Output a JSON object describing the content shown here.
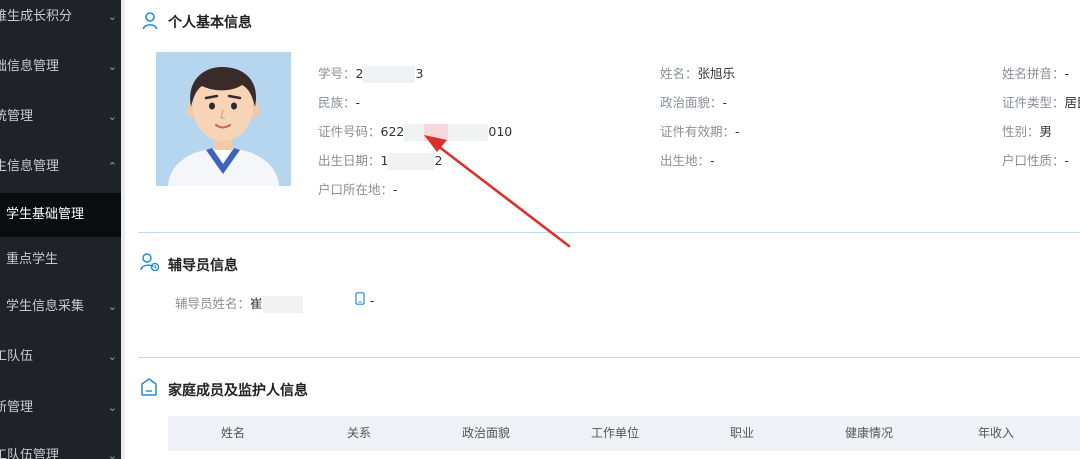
{
  "sidebar": {
    "items": [
      {
        "label": "难生成长积分",
        "arrow": "⌄"
      },
      {
        "label": "础信息管理",
        "arrow": "⌄"
      },
      {
        "label": "统管理",
        "arrow": "⌄"
      },
      {
        "label": "生信息管理",
        "arrow": "⌃"
      },
      {
        "label": "学生基础管理",
        "arrow": ""
      },
      {
        "label": "重点学生",
        "arrow": ""
      },
      {
        "label": "学生信息采集",
        "arrow": "⌄"
      },
      {
        "label": "工队伍",
        "arrow": "⌄"
      },
      {
        "label": "新管理",
        "arrow": "⌄"
      },
      {
        "label": "工队伍管理",
        "arrow": "⌄"
      }
    ]
  },
  "personal": {
    "title": "个人基本信息",
    "fields": {
      "student_id": {
        "label": "学号：",
        "value_pre": "2",
        "value_post": "3"
      },
      "name": {
        "label": "姓名：",
        "value": "张旭乐"
      },
      "name_pinyin": {
        "label": "姓名拼音：",
        "value": "-"
      },
      "ethnicity": {
        "label": "民族：",
        "value": "-"
      },
      "political": {
        "label": "政治面貌：",
        "value": "-"
      },
      "id_type": {
        "label": "证件类型：",
        "value": "居民"
      },
      "id_number": {
        "label": "证件号码：",
        "value_pre": "622",
        "value_post": "010"
      },
      "id_validity": {
        "label": "证件有效期：",
        "value": "-"
      },
      "gender": {
        "label": "性别：",
        "value": "男"
      },
      "birth_date": {
        "label": "出生日期：",
        "value_pre": "1",
        "value_post": "2"
      },
      "birthplace": {
        "label": "出生地：",
        "value": "-"
      },
      "household_type": {
        "label": "户口性质：",
        "value": "-"
      },
      "household_location": {
        "label": "户口所在地：",
        "value": "-"
      }
    }
  },
  "counselor": {
    "title": "辅导员信息",
    "name_label": "辅导员姓名：",
    "name_value": "崔",
    "phone_value": "-"
  },
  "family": {
    "title": "家庭成员及监护人信息",
    "columns": [
      "姓名",
      "关系",
      "政治面貌",
      "工作单位",
      "职业",
      "健康情况",
      "年收入"
    ]
  },
  "colors": {
    "accent": "#1e8fd8",
    "arrow": "#d9302c",
    "sidebar_bg": "#1f2227"
  },
  "icons": {
    "personal": "person-icon",
    "counselor": "counselor-icon",
    "family": "home-icon",
    "phone": "phone-icon"
  }
}
